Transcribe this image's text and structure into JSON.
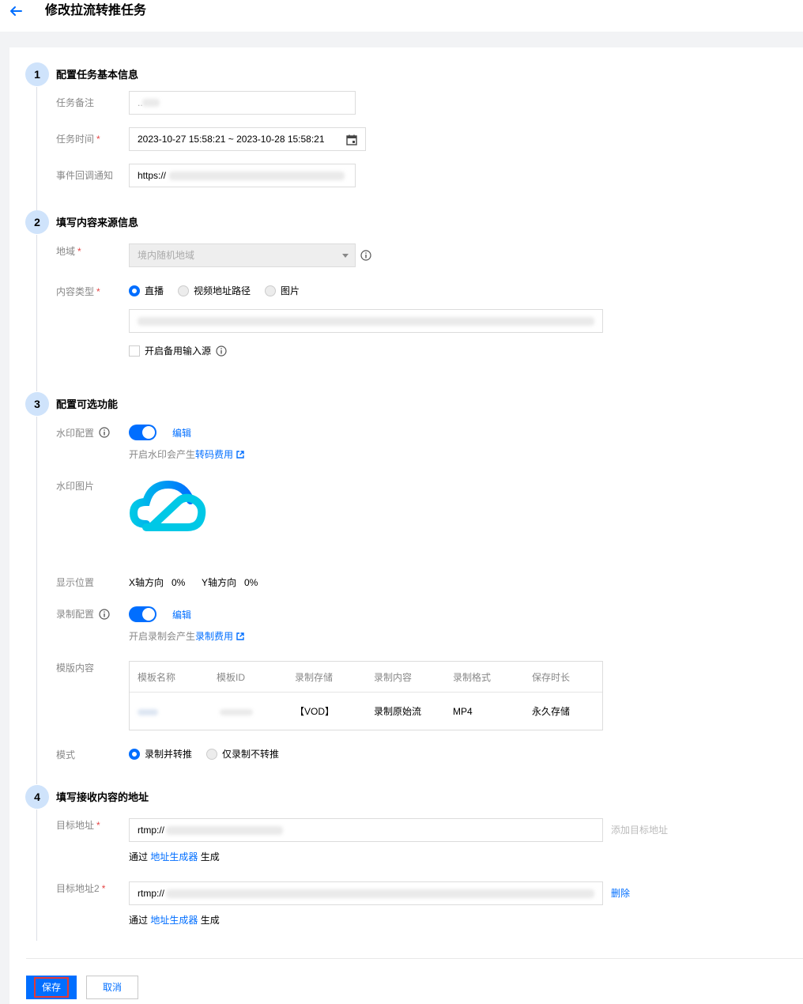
{
  "header": {
    "title": "修改拉流转推任务"
  },
  "step1": {
    "number": "1",
    "title": "配置任务基本信息",
    "remark_label": "任务备注",
    "remark_value": "..",
    "time_label": "任务时间",
    "required_mark": "*",
    "time_range": "2023-10-27 15:58:21   ~ 2023-10-28 15:58:21",
    "callback_label": "事件回调通知",
    "callback_value": "https://"
  },
  "step2": {
    "number": "2",
    "title": "填写内容来源信息",
    "region_label": "地域",
    "region_value": "境内随机地域",
    "content_type_label": "内容类型",
    "content_type_options": [
      "直播",
      "视频地址路径",
      "图片"
    ],
    "content_type_selected": "直播",
    "backup_source_label": "开启备用输入源"
  },
  "step3": {
    "number": "3",
    "title": "配置可选功能",
    "watermark_label": "水印配置",
    "watermark_enabled": true,
    "watermark_edit": "编辑",
    "watermark_note_prefix": "开启水印会产生",
    "watermark_note_link": "转码费用",
    "watermark_image_label": "水印图片",
    "position_label": "显示位置",
    "x_label": "X轴方向",
    "x_value": "0%",
    "y_label": "Y轴方向",
    "y_value": "0%",
    "record_label": "录制配置",
    "record_enabled": true,
    "record_edit": "编辑",
    "record_note_prefix": "开启录制会产生",
    "record_note_link": "录制费用",
    "template_label": "模版内容",
    "template_headers": [
      "模板名称",
      "模板ID",
      "录制存储",
      "录制内容",
      "录制格式",
      "保存时长"
    ],
    "template_row": {
      "storage": "【VOD】",
      "content": "录制原始流",
      "format": "MP4",
      "duration": "永久存储"
    },
    "mode_label": "模式",
    "mode_options": [
      "录制并转推",
      "仅录制不转推"
    ],
    "mode_selected": "录制并转推"
  },
  "step4": {
    "number": "4",
    "title": "填写接收内容的地址",
    "target1_label": "目标地址",
    "target1_value": "rtmp://",
    "add_target": "添加目标地址",
    "via_prefix": "通过",
    "generator_link": "地址生成器",
    "via_suffix": "生成",
    "target2_label": "目标地址2",
    "target2_value": "rtmp://",
    "delete": "删除"
  },
  "footer": {
    "save": "保存",
    "cancel": "取消"
  },
  "colors": {
    "primary": "#006eff",
    "step_bg": "#cfe3fb",
    "required": "#e54545",
    "highlight": "#e53935"
  }
}
